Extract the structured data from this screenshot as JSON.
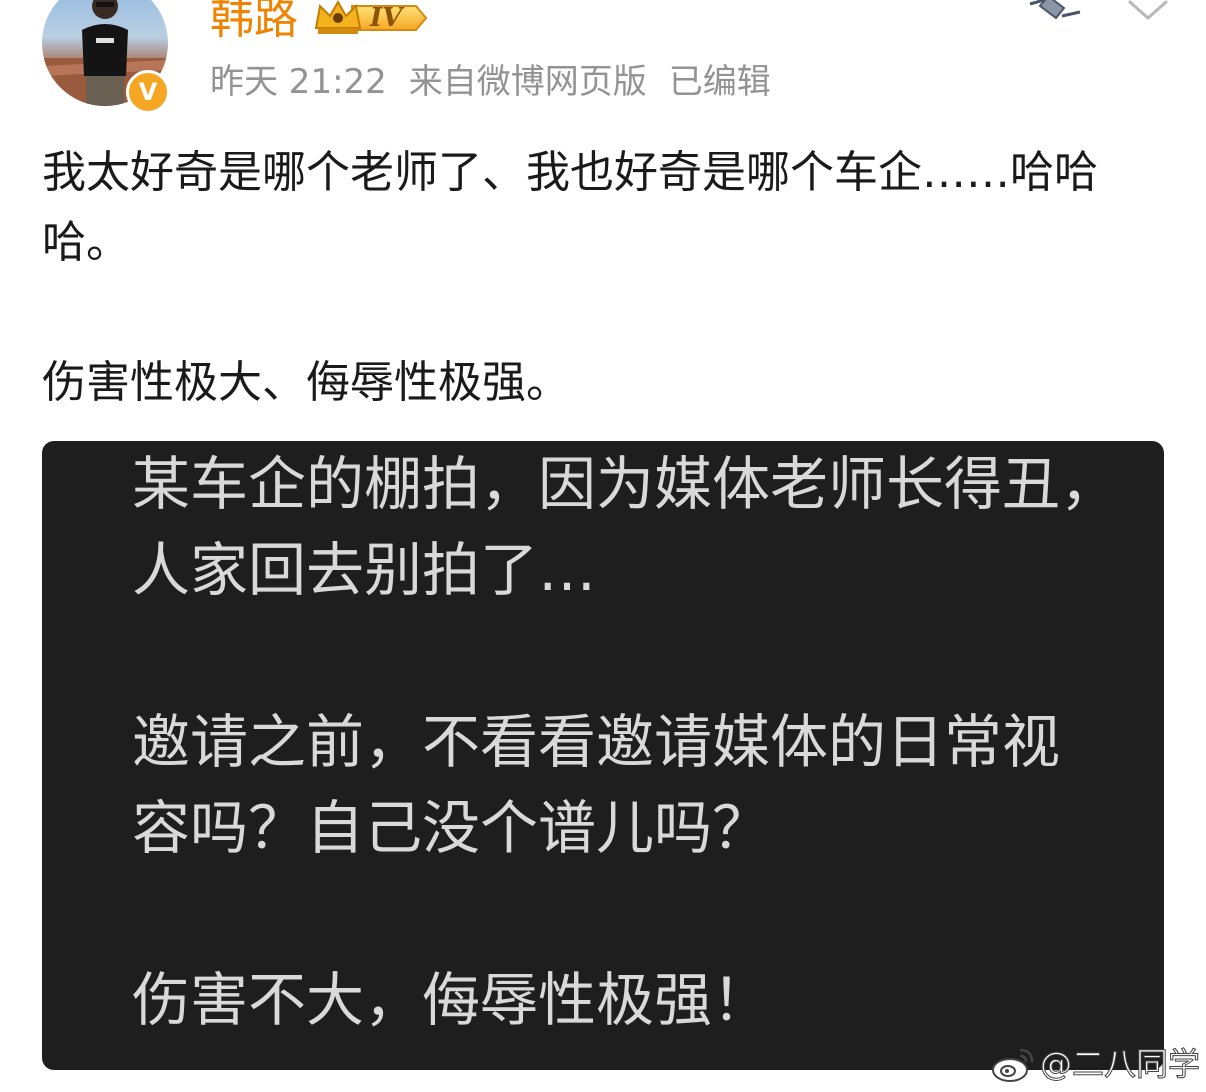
{
  "post": {
    "author": {
      "name": "韩路",
      "level": "IV",
      "verified_mark": "V"
    },
    "meta": {
      "time": "昨天 21:22",
      "source": "来自微博网页版",
      "edited": "已编辑"
    },
    "body": [
      "我太好奇是哪个老师了、我也好奇是哪个车企……哈哈哈。",
      "伤害性极大、侮辱性极强。"
    ]
  },
  "image": {
    "lines": [
      "某车企的棚拍，因为媒体老师长得丑，",
      "人家回去别拍了…",
      "邀请之前，不看看邀请媒体的日常视",
      "容吗？自己没个谱儿吗？",
      "伤害不大，侮辱性极强！"
    ]
  },
  "watermark": {
    "text": "@二八同学"
  },
  "icons": {
    "verified": "verified-v-badge-icon",
    "level": "crown-level-icon",
    "more": "chevron-down-icon",
    "top_right": "satellite-icon",
    "watermark": "weibo-logo-icon"
  },
  "colors": {
    "username": "#f08300",
    "meta": "#939393",
    "body_text": "#1a1a1a",
    "image_bg": "#1e1e1e",
    "image_text": "#d9d9d9",
    "verified_badge": "#f5a623"
  }
}
